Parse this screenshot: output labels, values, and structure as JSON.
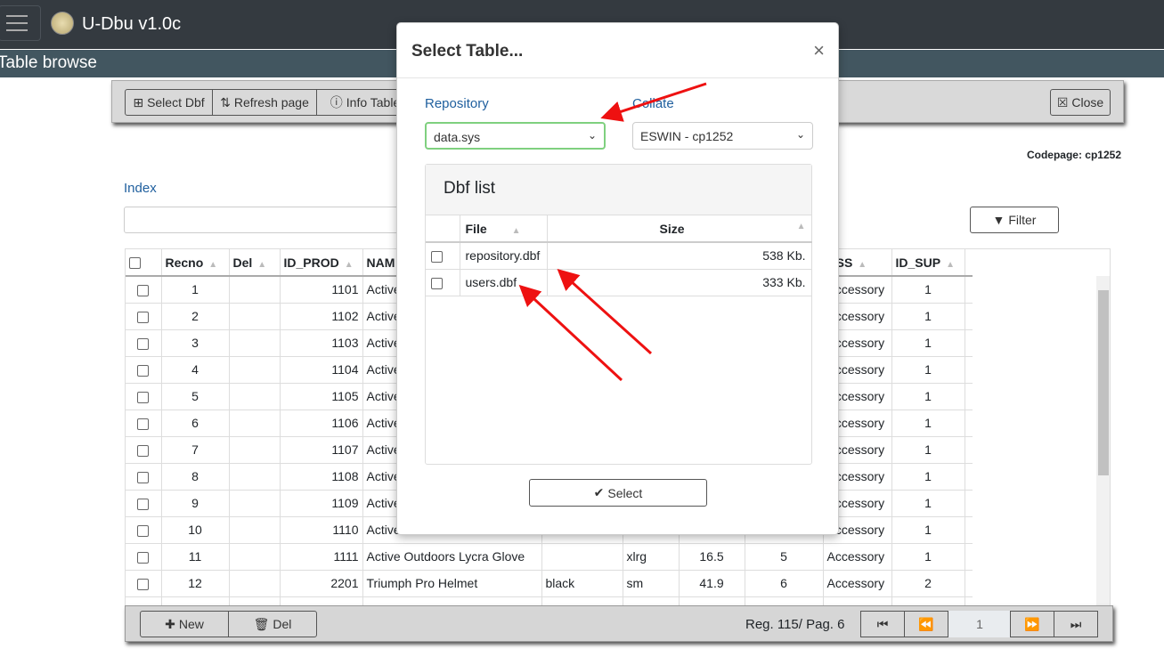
{
  "app": {
    "title": "U-Dbu v1.0c",
    "section": "Table browse"
  },
  "toolbar": {
    "select_dbf": "Select Dbf",
    "refresh": "Refresh page",
    "info": "Info Table",
    "close": "Close"
  },
  "codepage": "Codepage: cp1252",
  "index_label": "Index",
  "filter_label": "Filter",
  "grid": {
    "headers": [
      "Recno",
      "Del",
      "ID_PROD",
      "NAM",
      "",
      "",
      "",
      "",
      "ASS",
      "ID_SUP"
    ],
    "rows": [
      [
        "1",
        "",
        "1101",
        "Active",
        "",
        "",
        "",
        "",
        "Accessory",
        "1"
      ],
      [
        "2",
        "",
        "1102",
        "Active",
        "",
        "",
        "",
        "",
        "Accessory",
        "1"
      ],
      [
        "3",
        "",
        "1103",
        "Active",
        "",
        "",
        "",
        "",
        "Accessory",
        "1"
      ],
      [
        "4",
        "",
        "1104",
        "Active",
        "",
        "",
        "",
        "",
        "Accessory",
        "1"
      ],
      [
        "5",
        "",
        "1105",
        "Active",
        "",
        "",
        "",
        "",
        "Accessory",
        "1"
      ],
      [
        "6",
        "",
        "1106",
        "Active",
        "",
        "",
        "",
        "",
        "Accessory",
        "1"
      ],
      [
        "7",
        "",
        "1107",
        "Active",
        "",
        "",
        "",
        "",
        "Accessory",
        "1"
      ],
      [
        "8",
        "",
        "1108",
        "Active",
        "",
        "",
        "",
        "",
        "Accessory",
        "1"
      ],
      [
        "9",
        "",
        "1109",
        "Active",
        "",
        "",
        "",
        "",
        "Accessory",
        "1"
      ],
      [
        "10",
        "",
        "1110",
        "Active",
        "",
        "",
        "",
        "",
        "Accessory",
        "1"
      ],
      [
        "11",
        "",
        "1111",
        "Active Outdoors Lycra Glove",
        "",
        "xlrg",
        "16.5",
        "5",
        "Accessory",
        "1"
      ],
      [
        "12",
        "",
        "2201",
        "Triumph Pro Helmet",
        "black",
        "sm",
        "41.9",
        "6",
        "Accessory",
        "2"
      ]
    ]
  },
  "footer": {
    "new": "New",
    "del": "Del",
    "status": "Reg. 115/ Pag. 6",
    "page": "1"
  },
  "modal": {
    "title": "Select Table...",
    "close": "×",
    "repo_label": "Repository",
    "repo_value": "data.sys",
    "collate_label": "Collate",
    "collate_value": "ESWIN - cp1252",
    "list_title": "Dbf list",
    "col_file": "File",
    "col_size": "Size",
    "files": [
      {
        "file": "repository.dbf",
        "size": "538 Kb."
      },
      {
        "file": "users.dbf",
        "size": "333 Kb."
      }
    ],
    "select": "Select"
  },
  "colors": {
    "topbar": "#343a40",
    "section": "#425660",
    "arrow": "#ee1111"
  }
}
